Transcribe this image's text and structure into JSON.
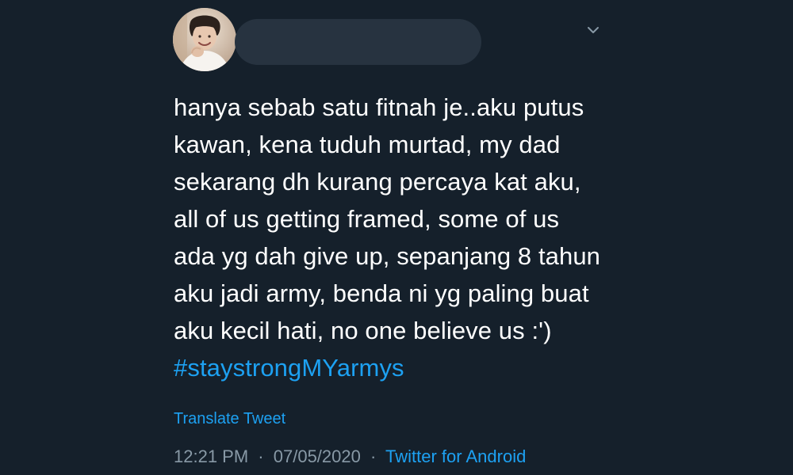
{
  "tweet": {
    "lines": [
      "hanya sebab satu fitnah je..aku putus",
      "kawan, kena tuduh murtad, my dad",
      "sekarang dh kurang percaya kat aku,",
      "all of us getting framed, some of us",
      "ada yg dah give up, sepanjang 8 tahun",
      "aku jadi army, benda ni yg paling buat",
      "aku kecil hati, no one believe us :')"
    ],
    "hashtag": "#staystrongMYarmys",
    "translate_label": "Translate Tweet",
    "time": "12:21 PM",
    "separator": "·",
    "date": "07/05/2020",
    "source": "Twitter for Android"
  },
  "icons": {
    "avatar": "profile-photo",
    "menu": "chevron-down-icon"
  },
  "colors": {
    "background": "#15202b",
    "text": "#ffffff",
    "link": "#1da1f2",
    "muted": "#8899a6",
    "redaction": "#273340"
  }
}
